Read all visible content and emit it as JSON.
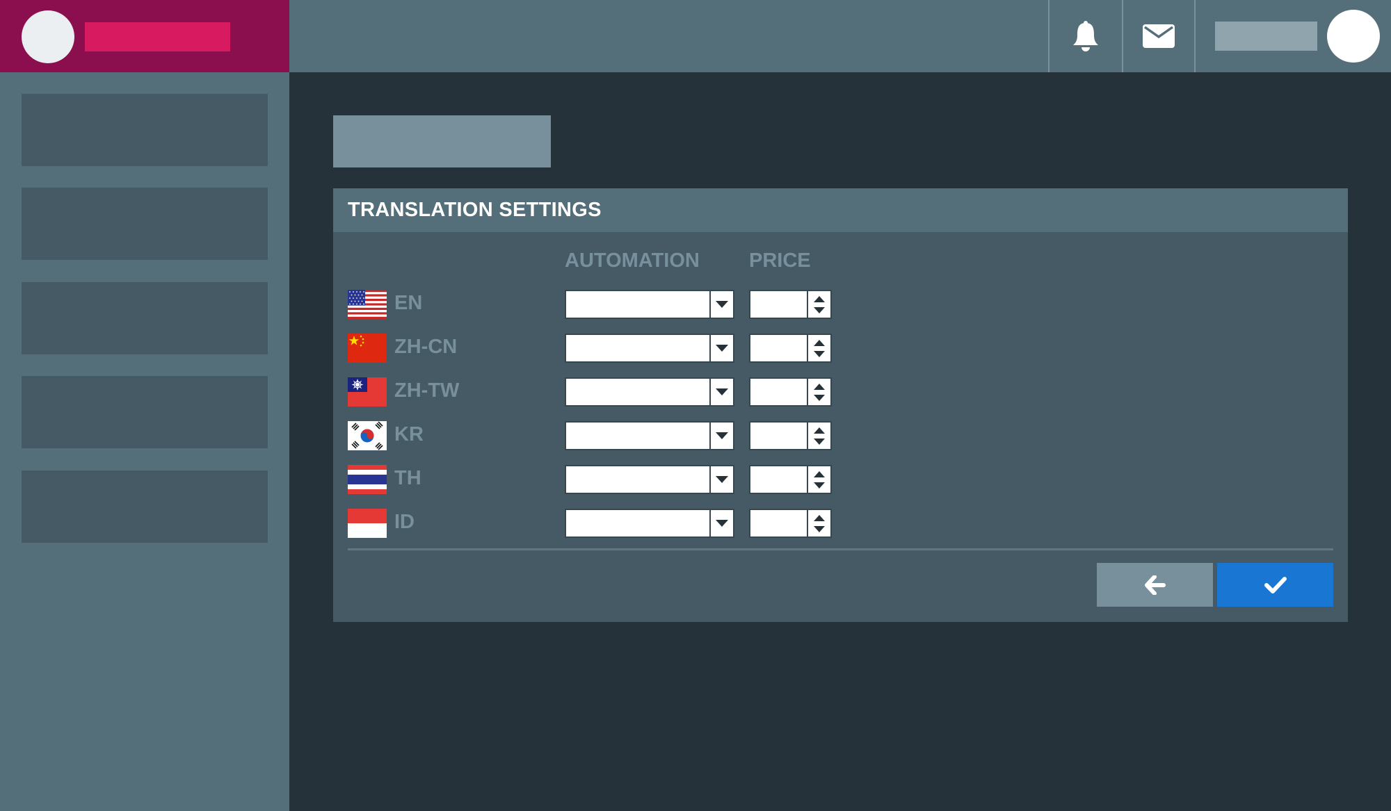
{
  "header": {
    "icons": [
      "bell-icon",
      "envelope-icon"
    ]
  },
  "panel": {
    "title": "TRANSLATION SETTINGS",
    "columns": {
      "automation": "AUTOMATION",
      "price": "PRICE"
    },
    "languages": [
      {
        "code": "EN",
        "flag": "us-flag-icon"
      },
      {
        "code": "ZH-CN",
        "flag": "cn-flag-icon"
      },
      {
        "code": "ZH-TW",
        "flag": "tw-flag-icon"
      },
      {
        "code": "KR",
        "flag": "kr-flag-icon"
      },
      {
        "code": "TH",
        "flag": "th-flag-icon"
      },
      {
        "code": "ID",
        "flag": "id-flag-icon"
      }
    ],
    "buttons": {
      "back_icon": "arrow-left-icon",
      "confirm_icon": "check-icon"
    }
  },
  "colors": {
    "brand": "#8b0e4f",
    "brand_accent": "#d81b60",
    "topbar": "#546e7a",
    "background": "#263239",
    "panel": "#455a64",
    "confirm": "#1976d2",
    "back": "#78909c"
  }
}
